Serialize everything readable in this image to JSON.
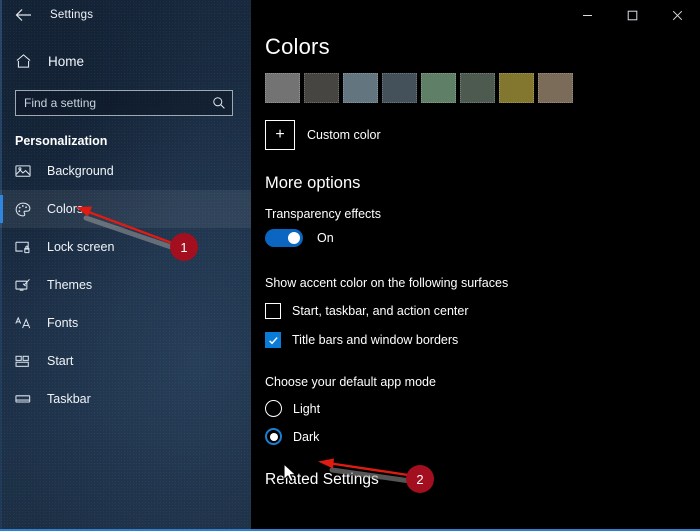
{
  "window": {
    "title": "Settings",
    "back_icon": "back-arrow-icon",
    "controls": {
      "minimize": "—",
      "maximize": "☐",
      "close": "✕"
    }
  },
  "sidebar": {
    "home": {
      "label": "Home",
      "icon": "home-icon"
    },
    "search": {
      "value": "",
      "placeholder": "Find a setting",
      "icon": "search-icon"
    },
    "section_title": "Personalization",
    "items": [
      {
        "label": "Background",
        "icon": "image-icon",
        "selected": false
      },
      {
        "label": "Colors",
        "icon": "palette-icon",
        "selected": true
      },
      {
        "label": "Lock screen",
        "icon": "lock-screen-icon",
        "selected": false
      },
      {
        "label": "Themes",
        "icon": "brush-icon",
        "selected": false
      },
      {
        "label": "Fonts",
        "icon": "fonts-aa-icon",
        "selected": false
      },
      {
        "label": "Start",
        "icon": "start-grid-icon",
        "selected": false
      },
      {
        "label": "Taskbar",
        "icon": "taskbar-icon",
        "selected": false
      }
    ],
    "accent_bar_color": "#2f86e0",
    "background_color": "#1b2e45"
  },
  "main": {
    "page_title": "Colors",
    "swatches": [
      {
        "name": "gray",
        "color": "#737373"
      },
      {
        "name": "dark-gray",
        "color": "#474542"
      },
      {
        "name": "steel-blue",
        "color": "#63757f"
      },
      {
        "name": "slate",
        "color": "#45515a"
      },
      {
        "name": "sage-green",
        "color": "#5f8067"
      },
      {
        "name": "dark-green-gray",
        "color": "#4c5a50"
      },
      {
        "name": "olive-gold",
        "color": "#83762f"
      },
      {
        "name": "warm-taupe",
        "color": "#7a6c58"
      }
    ],
    "custom_color": {
      "label": "Custom color",
      "plus_glyph": "+"
    },
    "more_options": {
      "heading": "More options",
      "transparency": {
        "label": "Transparency effects",
        "state": "On",
        "on": true,
        "accent": "#0a66c0"
      }
    },
    "accent_surfaces": {
      "heading": "Show accent color on the following surfaces",
      "checkboxes": [
        {
          "label": "Start, taskbar, and action center",
          "checked": false
        },
        {
          "label": "Title bars and window borders",
          "checked": true
        }
      ],
      "check_glyph": "✓",
      "checked_color": "#0a7bd6"
    },
    "app_mode": {
      "heading": "Choose your default app mode",
      "options": [
        {
          "label": "Light",
          "selected": false
        },
        {
          "label": "Dark",
          "selected": true
        }
      ],
      "selected_ring_color": "#1a7fd4"
    },
    "related_settings": "Related Settings"
  },
  "annotations": {
    "badge_color": "#a30f1e",
    "arrow_color": "#e01b12",
    "items": [
      {
        "number": "1",
        "target": "sidebar-item-colors"
      },
      {
        "number": "2",
        "target": "radio-dark"
      }
    ]
  }
}
